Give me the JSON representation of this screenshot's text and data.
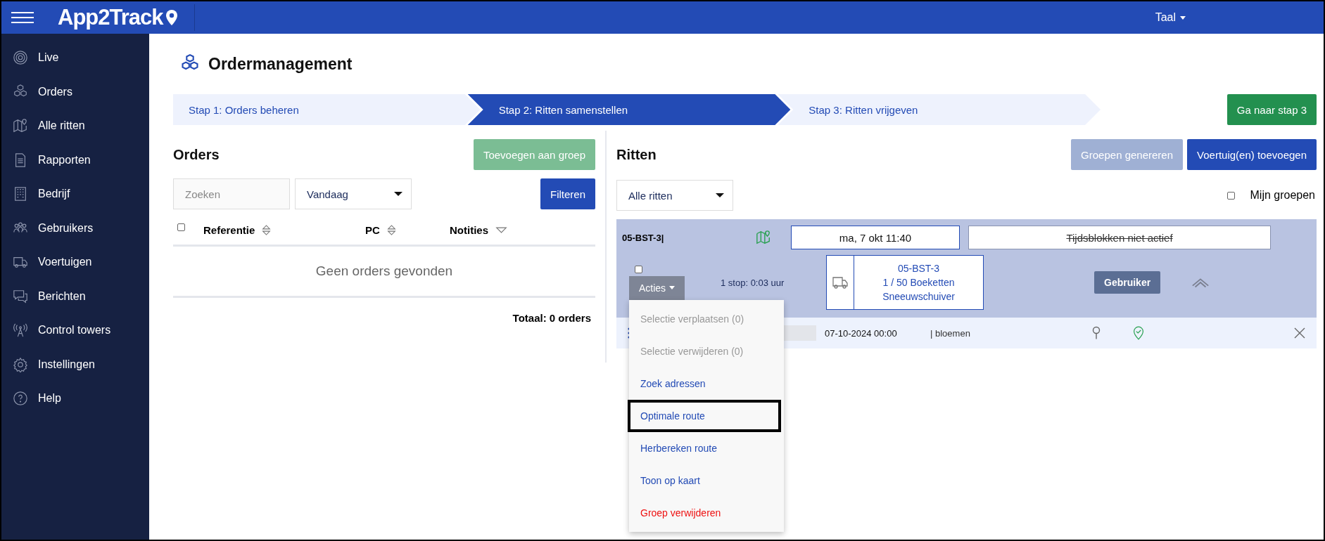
{
  "header": {
    "logo": "App2Track",
    "language": "Taal"
  },
  "sidebar": {
    "items": [
      {
        "label": "Live"
      },
      {
        "label": "Orders"
      },
      {
        "label": "Alle ritten"
      },
      {
        "label": "Rapporten"
      },
      {
        "label": "Bedrijf"
      },
      {
        "label": "Gebruikers"
      },
      {
        "label": "Voertuigen"
      },
      {
        "label": "Berichten"
      },
      {
        "label": "Control towers"
      },
      {
        "label": "Instellingen"
      },
      {
        "label": "Help"
      }
    ]
  },
  "page": {
    "title": "Ordermanagement"
  },
  "steps": [
    {
      "label": "Stap 1: Orders beheren",
      "selected": false
    },
    {
      "label": "Stap 2: Ritten samenstellen",
      "selected": true
    },
    {
      "label": "Stap 3: Ritten vrijgeven",
      "selected": false
    }
  ],
  "next_step_button": "Ga naar stap 3",
  "orders": {
    "title": "Orders",
    "add_button": {
      "label": "Toevoegen aan groep",
      "disabled": true
    },
    "search": {
      "placeholder": "Zoeken"
    },
    "period": "Vandaag",
    "filter_button": "Filteren",
    "select_all_checked": false,
    "columns": [
      {
        "label": "Referentie",
        "kind": "sortable"
      },
      {
        "label": "PC",
        "kind": "sortable"
      },
      {
        "label": "Notities",
        "kind": "filter"
      }
    ],
    "empty_text": "Geen orders gevonden",
    "total": "Totaal: 0 orders"
  },
  "rides": {
    "title": "Ritten",
    "generate_button": {
      "label": "Groepen genereren",
      "disabled": true
    },
    "add_vehicle_button": {
      "label": "Voertuig(en) toevoegen",
      "disabled": false
    },
    "filter": "Alle ritten",
    "my_groups": {
      "label": "Mijn groepen",
      "checked": false
    },
    "group": {
      "name": "05-BST-3|",
      "date": "ma, 7 okt 11:40",
      "timeblocks": {
        "label": "Tijdsblokken niet actief",
        "active": false
      },
      "checked": false,
      "actions_button": "Acties",
      "stops_summary": "1 stop: 0:03 uur",
      "vehicle": {
        "plate": "05-BST-3",
        "load": "1 / 50 Boeketten",
        "name": "Sneeuwschuiver"
      },
      "user_button": "Gebruiker",
      "expanded": true,
      "stops": [
        {
          "date": "07-10-2024 00:00",
          "note": "| bloemen"
        }
      ]
    },
    "menu": [
      {
        "label": "Selectie verplaatsen (0)",
        "kind": "disabled",
        "highlighted": false
      },
      {
        "label": "Selectie verwijderen (0)",
        "kind": "disabled",
        "highlighted": false
      },
      {
        "label": "Zoek adressen",
        "kind": "action",
        "highlighted": false
      },
      {
        "label": "Optimale route",
        "kind": "action",
        "highlighted": true
      },
      {
        "label": "Herbereken route",
        "kind": "action",
        "highlighted": false
      },
      {
        "label": "Toon op kaart",
        "kind": "action",
        "highlighted": false
      },
      {
        "label": "Groep verwijderen",
        "kind": "danger",
        "highlighted": false
      }
    ]
  }
}
